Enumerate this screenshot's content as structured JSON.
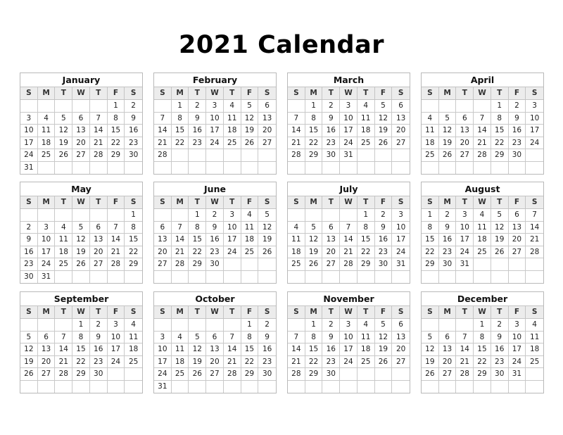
{
  "title": "2021 Calendar",
  "weekdays": [
    "S",
    "M",
    "T",
    "W",
    "T",
    "F",
    "S"
  ],
  "months": [
    {
      "name": "January",
      "start": 5,
      "days": 31
    },
    {
      "name": "February",
      "start": 1,
      "days": 28
    },
    {
      "name": "March",
      "start": 1,
      "days": 31
    },
    {
      "name": "April",
      "start": 4,
      "days": 30
    },
    {
      "name": "May",
      "start": 6,
      "days": 31
    },
    {
      "name": "June",
      "start": 2,
      "days": 30
    },
    {
      "name": "July",
      "start": 4,
      "days": 31
    },
    {
      "name": "August",
      "start": 0,
      "days": 31
    },
    {
      "name": "September",
      "start": 3,
      "days": 30
    },
    {
      "name": "October",
      "start": 5,
      "days": 31
    },
    {
      "name": "November",
      "start": 1,
      "days": 30
    },
    {
      "name": "December",
      "start": 3,
      "days": 31
    }
  ]
}
